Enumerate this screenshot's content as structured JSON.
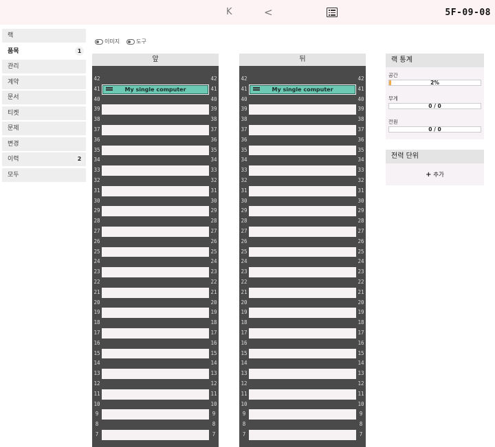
{
  "topbar": {
    "first_icon": "K",
    "prev_icon": "<",
    "list_icon": "list-view-icon",
    "rack_name": "5F-09-08"
  },
  "sidebar": {
    "items": [
      {
        "label": "랙",
        "badge": ""
      },
      {
        "label": "품목",
        "badge": "1",
        "active": true
      },
      {
        "label": "관리",
        "badge": ""
      },
      {
        "label": "계약",
        "badge": ""
      },
      {
        "label": "문서",
        "badge": ""
      },
      {
        "label": "티켓",
        "badge": ""
      },
      {
        "label": "문제",
        "badge": ""
      },
      {
        "label": "변경",
        "badge": ""
      },
      {
        "label": "이력",
        "badge": "2"
      },
      {
        "label": "모두",
        "badge": ""
      }
    ]
  },
  "toggles": {
    "images_label": "이미지",
    "tools_label": "도구"
  },
  "racks": {
    "front_label": "앞",
    "rear_label": "뒤",
    "units": [
      42,
      41,
      40,
      39,
      38,
      37,
      36,
      35,
      34,
      33,
      32,
      31,
      30,
      29,
      28,
      27,
      26,
      25,
      24,
      23,
      22,
      21,
      20,
      19,
      18,
      17,
      16,
      15,
      14,
      13,
      12,
      11,
      10,
      9,
      8,
      7
    ],
    "device_name": "My single computer",
    "device_unit": 41
  },
  "stats": {
    "title": "랙 통계",
    "space_label": "공간",
    "space_value": "2%",
    "space_fraction": 0.02,
    "weight_label": "무게",
    "weight_value": "0 / 0",
    "power_label": "전원",
    "power_value": "0 / 0"
  },
  "power_units": {
    "title": "전력 단위",
    "add_label": "추가"
  },
  "colors": {
    "device": "#6cc9b4",
    "rack_frame": "#4a4a4a",
    "space_fill": "#f0ad4e"
  }
}
